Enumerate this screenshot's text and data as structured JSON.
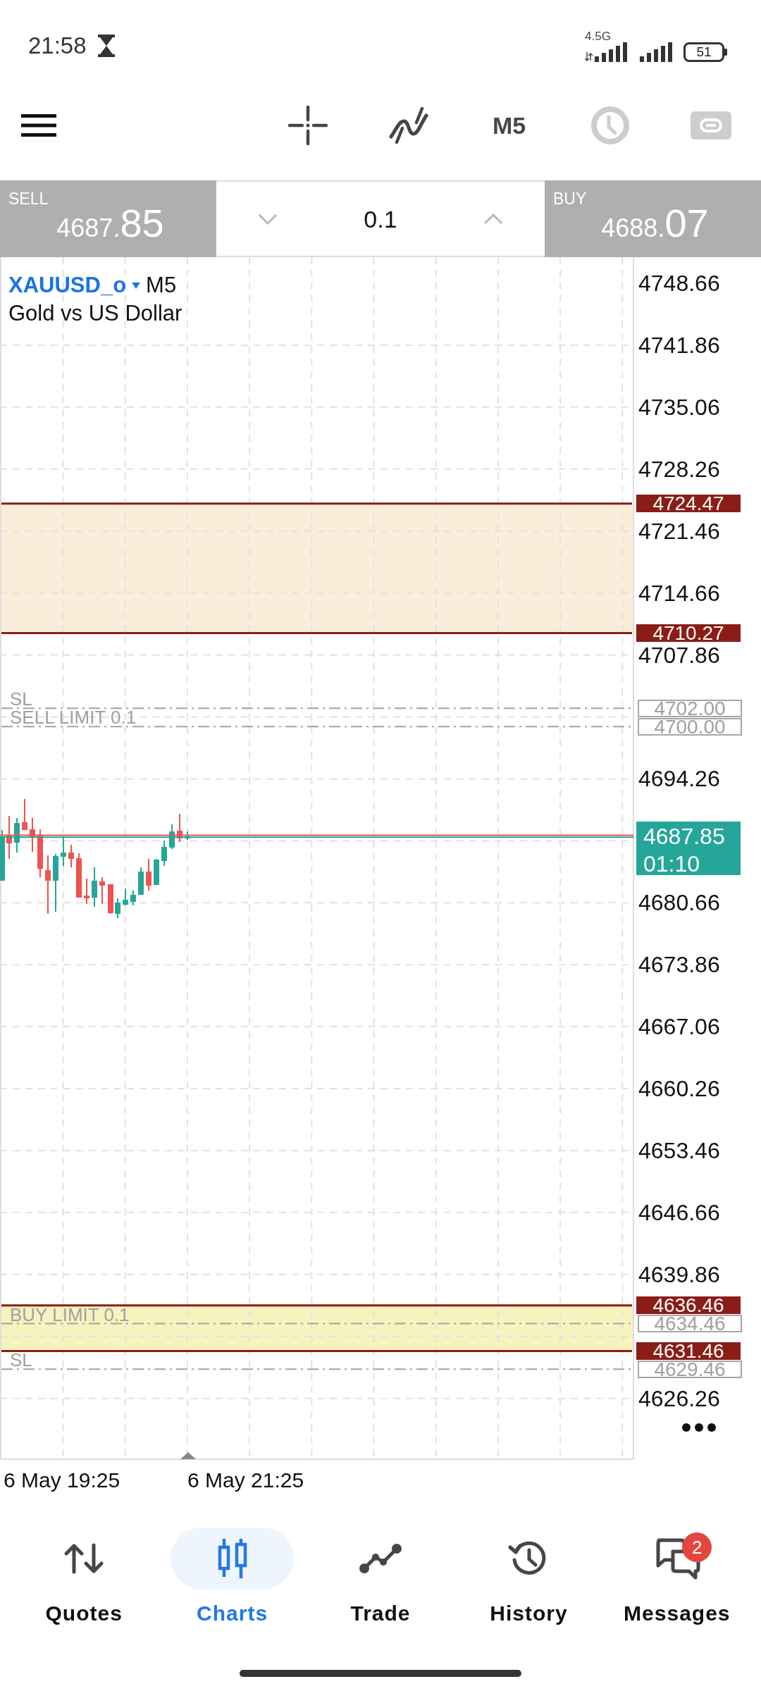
{
  "status_bar": {
    "time": "21:58",
    "network": "4.5G",
    "battery": "51"
  },
  "toolbar": {
    "tools": [
      {
        "kind": "crosshair",
        "disabled": false
      },
      {
        "kind": "indicators",
        "disabled": false
      },
      {
        "kind": "timeframe",
        "label": "M5",
        "disabled": false
      },
      {
        "kind": "clock",
        "disabled": true
      },
      {
        "kind": "trading",
        "disabled": true
      }
    ]
  },
  "trade_bar": {
    "sell": {
      "label": "SELL",
      "price_head": "4687.",
      "price_tail": "85"
    },
    "volume": "0.1",
    "buy": {
      "label": "BUY",
      "price_head": "4688.",
      "price_tail": "07"
    }
  },
  "chart": {
    "symbol": "XAUUSD_o",
    "timeframe": "M5",
    "description": "Gold vs US Dollar",
    "price_ticks": [
      "4748.66",
      "4741.86",
      "4735.06",
      "4728.26",
      "4721.46",
      "4714.66",
      "4707.86",
      "4694.26",
      "4680.66",
      "4673.86",
      "4667.06",
      "4660.26",
      "4653.46",
      "4646.66",
      "4639.86",
      "4626.26"
    ],
    "zones": [
      {
        "color": "#faeedb",
        "upper": "4724.47",
        "lower": "4710.27"
      },
      {
        "color": "#f6f3bf",
        "upper": "4636.46",
        "lower": "4631.46"
      }
    ],
    "orders": [
      {
        "label": "SL",
        "price": "4702.00"
      },
      {
        "label": "SELL LIMIT 0.1",
        "price": "4700.00"
      },
      {
        "label": "BUY LIMIT 0.1",
        "price": "4634.46"
      },
      {
        "label": "SL",
        "price": "4629.46"
      }
    ],
    "current": {
      "price": "4687.85",
      "countdown": "01:10"
    },
    "time_labels": [
      "6 May 19:25",
      "6 May 21:25"
    ]
  },
  "nav": [
    {
      "kind": "quotes",
      "label": "Quotes",
      "selected": false
    },
    {
      "kind": "charts",
      "label": "Charts",
      "selected": true
    },
    {
      "kind": "trade",
      "label": "Trade",
      "selected": false
    },
    {
      "kind": "history",
      "label": "History",
      "selected": false
    },
    {
      "kind": "messages",
      "label": "Messages",
      "selected": false,
      "badge": "2"
    }
  ]
}
